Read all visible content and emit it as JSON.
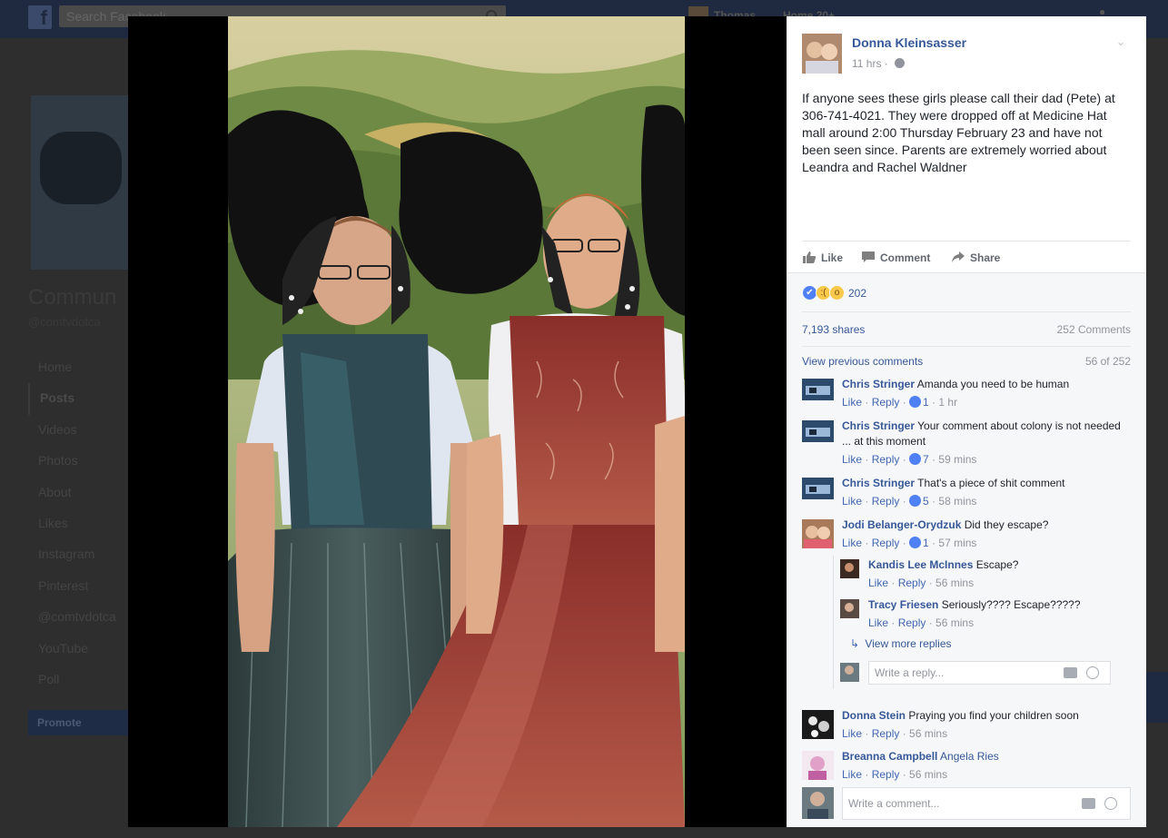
{
  "background": {
    "search_placeholder": "Search Facebook",
    "user_name": "Thomas",
    "home_label": "Home",
    "home_count": "20+",
    "page_name": "Commun",
    "page_handle": "@comtvdotca",
    "nav": [
      "Home",
      "Posts",
      "Videos",
      "Photos",
      "About",
      "Likes",
      "Instagram",
      "Pinterest",
      "@comtvdotca",
      "YouTube",
      "Poll"
    ],
    "promote": "Promote"
  },
  "post": {
    "author": "Donna Kleinsasser",
    "time": "11 hrs",
    "text": "If anyone sees these girls please call their dad (Pete) at 306-741-4021. They were dropped off at Medicine Hat mall around 2:00 Thursday February 23 and have not been seen since. Parents are extremely worried about Leandra and Rachel Waldner",
    "actions": {
      "like": "Like",
      "comment": "Comment",
      "share": "Share"
    },
    "reaction_count": "202",
    "shares": "7,193 shares",
    "comments_total": "252 Comments",
    "view_previous": "View previous comments",
    "comments_pager": "56 of 252"
  },
  "comments": [
    {
      "name": "Chris Stringer",
      "text": "Amanda you need to be human",
      "like": "Like",
      "reply": "Reply",
      "likes": "1",
      "time": "1 hr"
    },
    {
      "name": "Chris Stringer",
      "text": "Your comment about colony is not needed ... at this moment",
      "like": "Like",
      "reply": "Reply",
      "likes": "7",
      "time": "59 mins"
    },
    {
      "name": "Chris Stringer",
      "text": "That's a piece of shit comment",
      "like": "Like",
      "reply": "Reply",
      "likes": "5",
      "time": "58 mins"
    },
    {
      "name": "Jodi Belanger-Orydzuk",
      "text": "Did they escape?",
      "like": "Like",
      "reply": "Reply",
      "likes": "1",
      "time": "57 mins"
    }
  ],
  "replies": [
    {
      "name": "Kandis Lee McInnes",
      "text": "Escape?",
      "like": "Like",
      "reply": "Reply",
      "time": "56 mins"
    },
    {
      "name": "Tracy Friesen",
      "text": "Seriously???? Escape?????",
      "like": "Like",
      "reply": "Reply",
      "time": "56 mins"
    }
  ],
  "more_replies": "View more replies",
  "reply_placeholder": "Write a reply...",
  "later_comments": [
    {
      "name": "Donna Stein",
      "text": "Praying you find your children soon",
      "like": "Like",
      "reply": "Reply",
      "time": "56 mins"
    },
    {
      "name": "Breanna Campbell",
      "tag": "Angela Ries",
      "like": "Like",
      "reply": "Reply",
      "time": "56 mins"
    }
  ],
  "comment_placeholder": "Write a comment...",
  "colors": {
    "link": "#365899",
    "meta": "#90949c",
    "accent": "#4267b2"
  }
}
